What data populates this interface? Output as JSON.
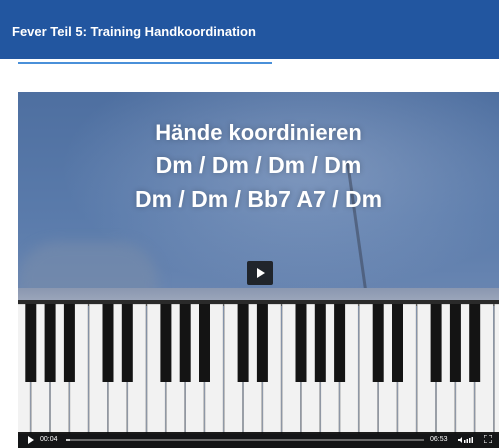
{
  "header": {
    "title": "Fever Teil 5: Training Handkoordination"
  },
  "video": {
    "overlay_lines": [
      "Hände koordinieren",
      "Dm / Dm / Dm / Dm",
      "Dm / Dm / Bb7 A7 / Dm"
    ],
    "controls": {
      "current_time": "00:04",
      "total_time": "06:53",
      "progress_fraction": 0.01
    }
  },
  "colors": {
    "header_bg": "#2256a0",
    "tab_underline": "#4a90d9",
    "controls_bg": "#0a0a0a"
  },
  "icons": [
    "play-icon",
    "volume-icon",
    "fullscreen-icon"
  ]
}
